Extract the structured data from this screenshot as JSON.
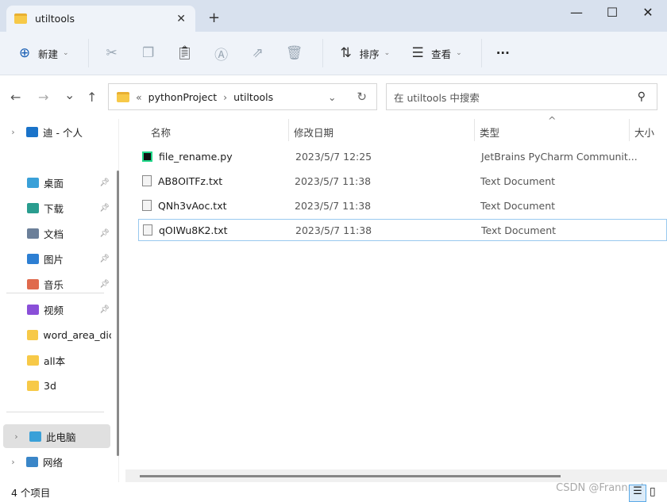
{
  "window": {
    "tab_title": "utiltools",
    "new_tab": "+",
    "minimize": "—",
    "maximize": "☐",
    "close": "✕",
    "tab_close": "✕"
  },
  "toolbar": {
    "new_label": "新建",
    "sort_label": "排序",
    "view_label": "查看",
    "more": "···"
  },
  "nav": {
    "back": "←",
    "forward": "→",
    "recent": "⌄",
    "up": "↑"
  },
  "address": {
    "prefix": "«",
    "segments": [
      "pythonProject",
      "utiltools"
    ],
    "sep": "›",
    "dropdown": "⌄",
    "refresh": "↻"
  },
  "search": {
    "placeholder": "在 utiltools 中搜索",
    "icon": "⚲"
  },
  "sidebar": {
    "items": [
      {
        "label": "迪 - 个人",
        "icon": "cloud-icon",
        "color": "#1a73c9",
        "expand": true
      },
      {
        "label": "桌面",
        "icon": "desktop-icon",
        "color": "#3aa0d8",
        "pin": true
      },
      {
        "label": "下载",
        "icon": "download-icon",
        "color": "#2a9d8f",
        "pin": true
      },
      {
        "label": "文档",
        "icon": "document-icon",
        "color": "#6b7f99",
        "pin": true
      },
      {
        "label": "图片",
        "icon": "pictures-icon",
        "color": "#2d7fd3",
        "pin": true
      },
      {
        "label": "音乐",
        "icon": "music-icon",
        "color": "#e06a4d",
        "pin": true
      },
      {
        "label": "视频",
        "icon": "video-icon",
        "color": "#8a4fd8",
        "pin": true
      },
      {
        "label": "word_area_dic",
        "icon": "folder-icon",
        "color": "#f7c948"
      },
      {
        "label": "all本",
        "icon": "folder-icon",
        "color": "#f7c948"
      },
      {
        "label": "3d",
        "icon": "folder-icon",
        "color": "#f7c948"
      },
      {
        "label": "此电脑",
        "icon": "computer-icon",
        "color": "#3aa0d8",
        "expand": true
      },
      {
        "label": "网络",
        "icon": "network-icon",
        "color": "#3a86c8",
        "expand": true
      }
    ]
  },
  "columns": {
    "name": "名称",
    "date": "修改日期",
    "type": "类型",
    "size": "大小",
    "sort": "^"
  },
  "files": [
    {
      "name": "file_rename.py",
      "date": "2023/5/7 12:25",
      "type": "JetBrains PyCharm Communit..."
    },
    {
      "name": "AB8OITFz.txt",
      "date": "2023/5/7 11:38",
      "type": "Text Document"
    },
    {
      "name": "QNh3vAoc.txt",
      "date": "2023/5/7 11:38",
      "type": "Text Document"
    },
    {
      "name": "qOIWu8K2.txt",
      "date": "2023/5/7 11:38",
      "type": "Text Document"
    }
  ],
  "status": {
    "count": "4 个项目",
    "watermark": "CSDN @Frannnet"
  }
}
